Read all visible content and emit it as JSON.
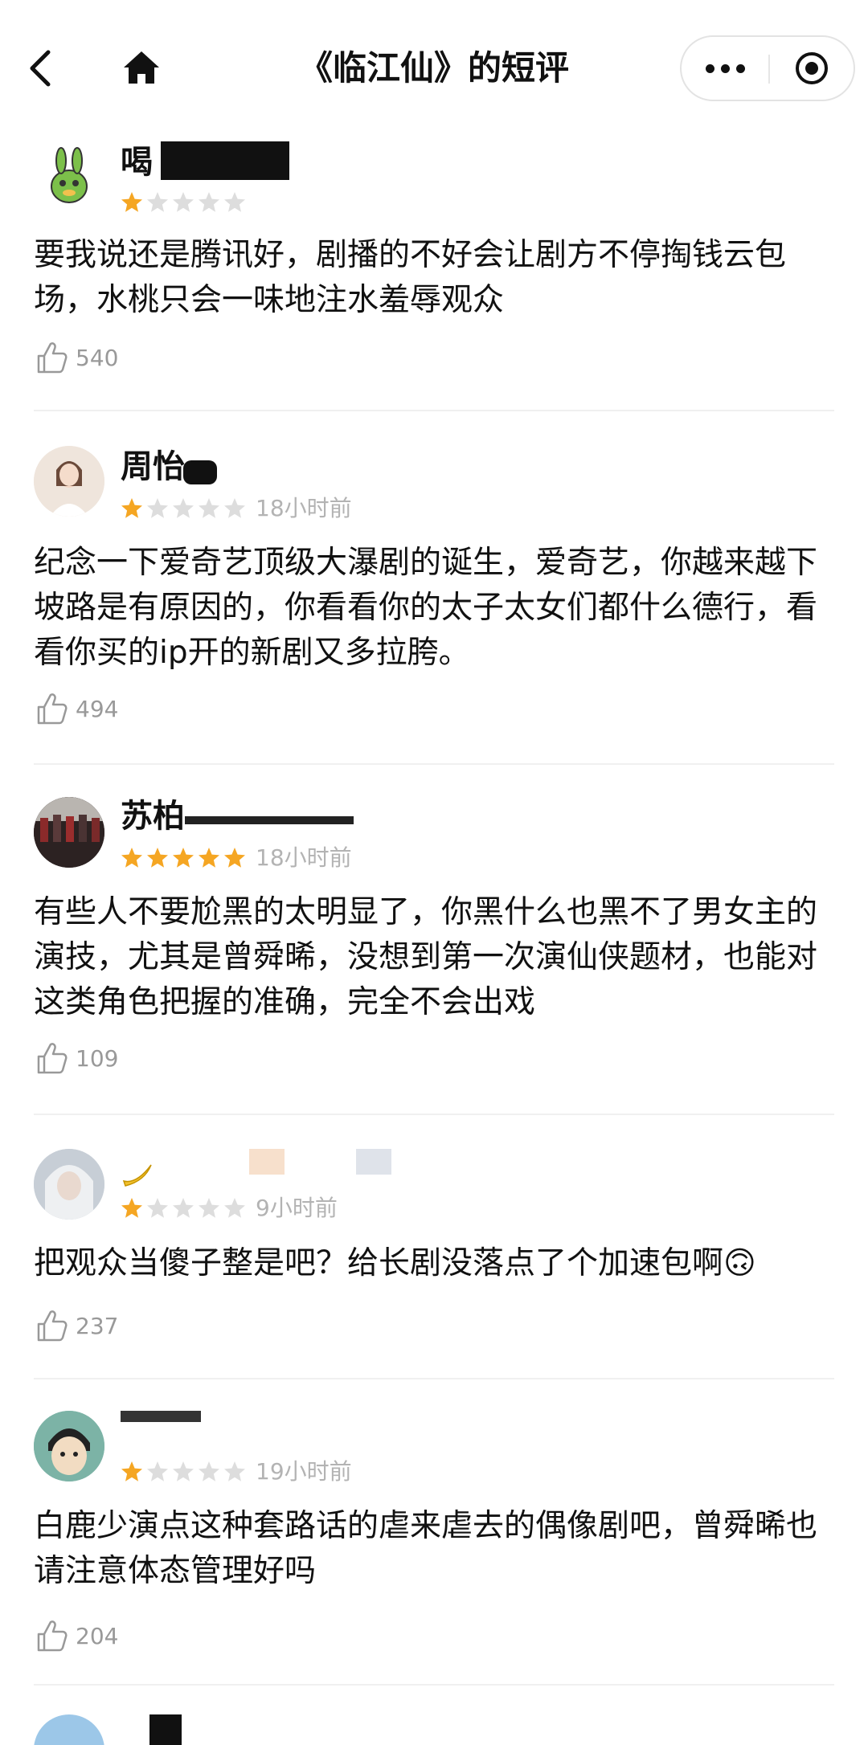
{
  "header": {
    "title": "《临江仙》的短评"
  },
  "colors": {
    "star_on": "#f5a623",
    "star_off": "#dddddd",
    "meta_text": "#b3b3b3"
  },
  "reviews": [
    {
      "name": "喝",
      "rating": 1,
      "time": "",
      "text": "要我说还是腾讯好，剧播的不好会让剧方不停掏钱云包场，水桃只会一味地注水羞辱观众",
      "likes": "540"
    },
    {
      "name": "周怡",
      "rating": 1,
      "time": "18小时前",
      "text": "纪念一下爱奇艺顶级大瀑剧的诞生，爱奇艺，你越来越下坡路是有原因的，你看看你的太子太女们都什么德行，看看你买的ip开的新剧又多拉胯。",
      "likes": "494"
    },
    {
      "name": "苏柏",
      "rating": 5,
      "time": "18小时前",
      "text": "有些人不要尬黑的太明显了，你黑什么也黑不了男女主的演技，尤其是曾舜晞，没想到第一次演仙侠题材，也能对这类角色把握的准确，完全不会出戏",
      "likes": "109"
    },
    {
      "name": "",
      "rating": 1,
      "time": "9小时前",
      "text": "把观众当傻子整是吧？给长剧没落点了个加速包啊🙃",
      "likes": "237"
    },
    {
      "name": "",
      "rating": 1,
      "time": "19小时前",
      "text": "白鹿少演点这种套路话的虐来虐去的偶像剧吧，曾舜晞也请注意体态管理好吗",
      "likes": "204"
    }
  ]
}
